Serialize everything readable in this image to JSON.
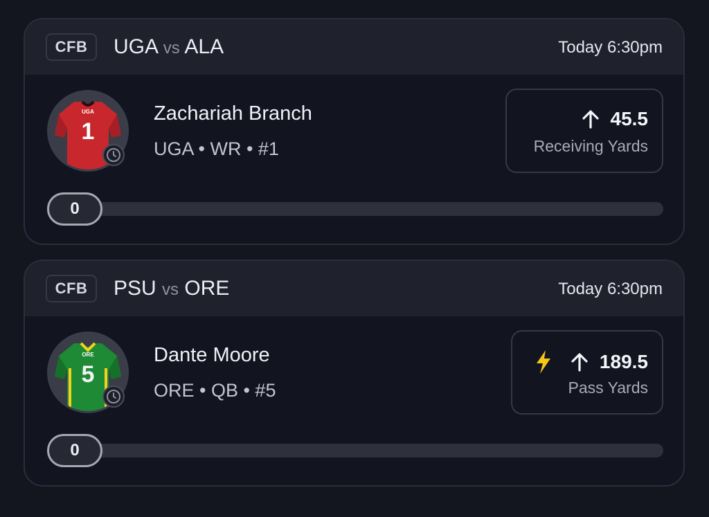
{
  "cards": [
    {
      "league": "CFB",
      "team_a": "UGA",
      "vs": "vs",
      "team_b": "ALA",
      "time": "Today 6:30pm",
      "player_name": "Zachariah Branch",
      "player_info": "UGA • WR • #1",
      "jersey": {
        "team": "UGA",
        "number": "1",
        "color": "#c8282d"
      },
      "prop_direction_icon": "arrow-up-icon",
      "prop_value": "45.5",
      "prop_stat": "Receiving Yards",
      "progress_value": "0",
      "has_boost": false
    },
    {
      "league": "CFB",
      "team_a": "PSU",
      "vs": "vs",
      "team_b": "ORE",
      "time": "Today 6:30pm",
      "player_name": "Dante Moore",
      "player_info": "ORE • QB • #5",
      "jersey": {
        "team": "ORE",
        "number": "5",
        "color": "#1e8a35",
        "trim": "#f2d31b"
      },
      "prop_direction_icon": "arrow-up-icon",
      "prop_value": "189.5",
      "prop_stat": "Pass Yards",
      "progress_value": "0",
      "has_boost": true,
      "boost_icon": "lightning-bolt-icon",
      "boost_color": "#f5c518"
    }
  ]
}
